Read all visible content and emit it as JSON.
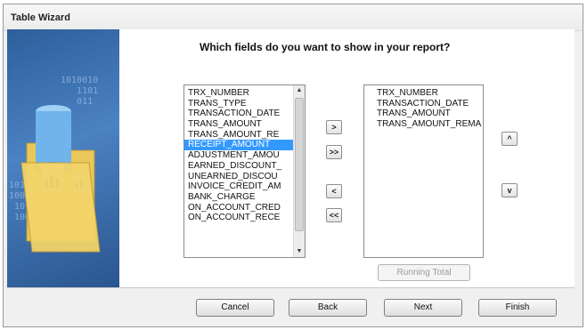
{
  "window": {
    "title": "Table Wizard"
  },
  "question": "Which fields do you want to show in your report?",
  "available_fields": {
    "items": [
      "TRX_NUMBER",
      "TRANS_TYPE",
      "TRANSACTION_DATE",
      "TRANS_AMOUNT",
      "TRANS_AMOUNT_RE",
      "RECEIPT_AMOUNT",
      "ADJUSTMENT_AMOU",
      "EARNED_DISCOUNT_",
      "UNEARNED_DISCOU",
      "INVOICE_CREDIT_AM",
      "BANK_CHARGE",
      "ON_ACCOUNT_CRED",
      "ON_ACCOUNT_RECE"
    ],
    "selected": "RECEIPT_AMOUNT"
  },
  "selected_fields": {
    "items": [
      "TRX_NUMBER",
      "TRANSACTION_DATE",
      "TRANS_AMOUNT",
      "TRANS_AMOUNT_REMA"
    ]
  },
  "transfer_buttons": {
    "add": ">",
    "add_all": ">>",
    "remove": "<",
    "remove_all": "<<"
  },
  "order_buttons": {
    "up": "^",
    "down": "v"
  },
  "running_total_label": "Running Total",
  "footer": {
    "cancel": "Cancel",
    "back": "Back",
    "next": "Next",
    "finish": "Finish"
  },
  "icons": {
    "scroll_up": "arrow-up-icon",
    "scroll_down": "arrow-down-icon"
  }
}
